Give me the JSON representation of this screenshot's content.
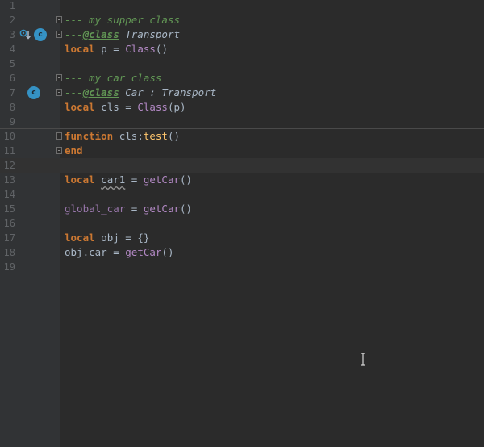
{
  "editor": {
    "line_numbers": [
      "1",
      "2",
      "3",
      "4",
      "5",
      "6",
      "7",
      "8",
      "9",
      "10",
      "11",
      "12",
      "13",
      "14",
      "15",
      "16",
      "17",
      "18",
      "19"
    ],
    "badge_letter": "c",
    "lines": {
      "l2": {
        "comment": "--- my supper class"
      },
      "l3": {
        "prefix": "---",
        "tag": "@class",
        "type": " Transport"
      },
      "l4": {
        "kw": "local",
        "text": " p = ",
        "call": "Class",
        "end": "()"
      },
      "l6": {
        "comment": "--- my car class"
      },
      "l7": {
        "prefix": "---",
        "tag": "@class",
        "type": " Car : Transport"
      },
      "l8": {
        "kw": "local",
        "text": " cls = ",
        "call": "Class",
        "end": "(p)"
      },
      "l10": {
        "kw": "function",
        "text": " cls:",
        "fn": "test",
        "end": "()"
      },
      "l11": {
        "kw": "end"
      },
      "l13": {
        "kw": "local",
        "sp": " ",
        "var": "car1",
        "text": " = ",
        "call": "getCar",
        "end": "()"
      },
      "l15": {
        "gvar": "global_car",
        "text": " = ",
        "call": "getCar",
        "end": "()"
      },
      "l17": {
        "kw": "local",
        "text": " obj = {}"
      },
      "l18": {
        "text": "obj.car = ",
        "call": "getCar",
        "end": "()"
      }
    }
  },
  "colors": {
    "background": "#2b2b2b",
    "gutter": "#313335",
    "keyword": "#cc7832",
    "comment": "#629755",
    "function_decl": "#ffc66d",
    "call": "#b389c5",
    "badge": "#3592c4"
  },
  "icons": {
    "class_badge": "class-c-icon",
    "override": "override-arrow-icon",
    "fold": "fold-marker-icon",
    "text_cursor": "ibeam-cursor-icon"
  }
}
